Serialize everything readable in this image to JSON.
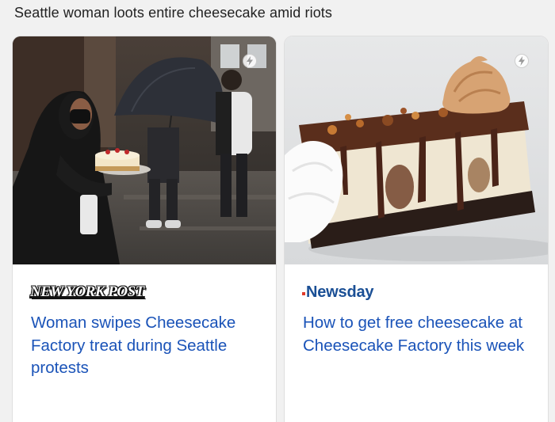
{
  "page": {
    "heading": "Seattle woman loots entire cheesecake amid riots"
  },
  "cards": [
    {
      "source": "NEW YORK POST",
      "title": "Woman swipes Cheesecake Factory treat during Seattle protests",
      "image": "woman-carrying-cheesecake-photo",
      "badge_icon": "amp-lightning-icon"
    },
    {
      "source": "Newsday",
      "title": "How to get free cheesecake at Cheesecake Factory this week",
      "image": "chocolate-caramel-cheesecake-slice-photo",
      "badge_icon": "amp-lightning-icon"
    }
  ],
  "colors": {
    "link": "#1a53b8",
    "newsday_brand": "#1a4f95",
    "background": "#f1f1f1"
  }
}
